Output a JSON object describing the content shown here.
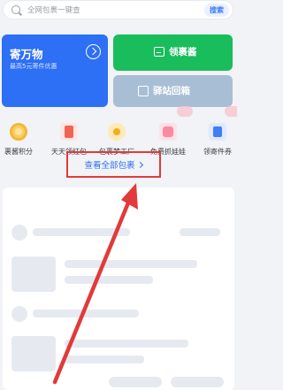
{
  "search": {
    "placeholder": "全网包裹一键查",
    "button_label": "搜索"
  },
  "cards": {
    "ship": {
      "title": "寄万物",
      "subtitle": "最高5元寄件优惠"
    },
    "pickup": {
      "label": "领裹酱"
    },
    "station": {
      "label": "驿站回箱"
    }
  },
  "quick_entries": [
    {
      "label": "裹酱积分",
      "icon": "coin-icon"
    },
    {
      "label": "天天领红包",
      "icon": "red-packet-icon"
    },
    {
      "label": "包裹梦工厂",
      "icon": "dream-factory-icon"
    },
    {
      "label": "免费抓娃娃",
      "icon": "claw-machine-icon"
    },
    {
      "label": "领寄件券",
      "icon": "coupon-icon"
    }
  ],
  "packages": {
    "view_all_label": "查看全部包裹"
  },
  "colors": {
    "primary_blue": "#2d6ff5",
    "green": "#19bd5b",
    "station_blue": "#a8bed4",
    "annotation_red": "#e23a3a",
    "background": "#f1f3f6"
  }
}
